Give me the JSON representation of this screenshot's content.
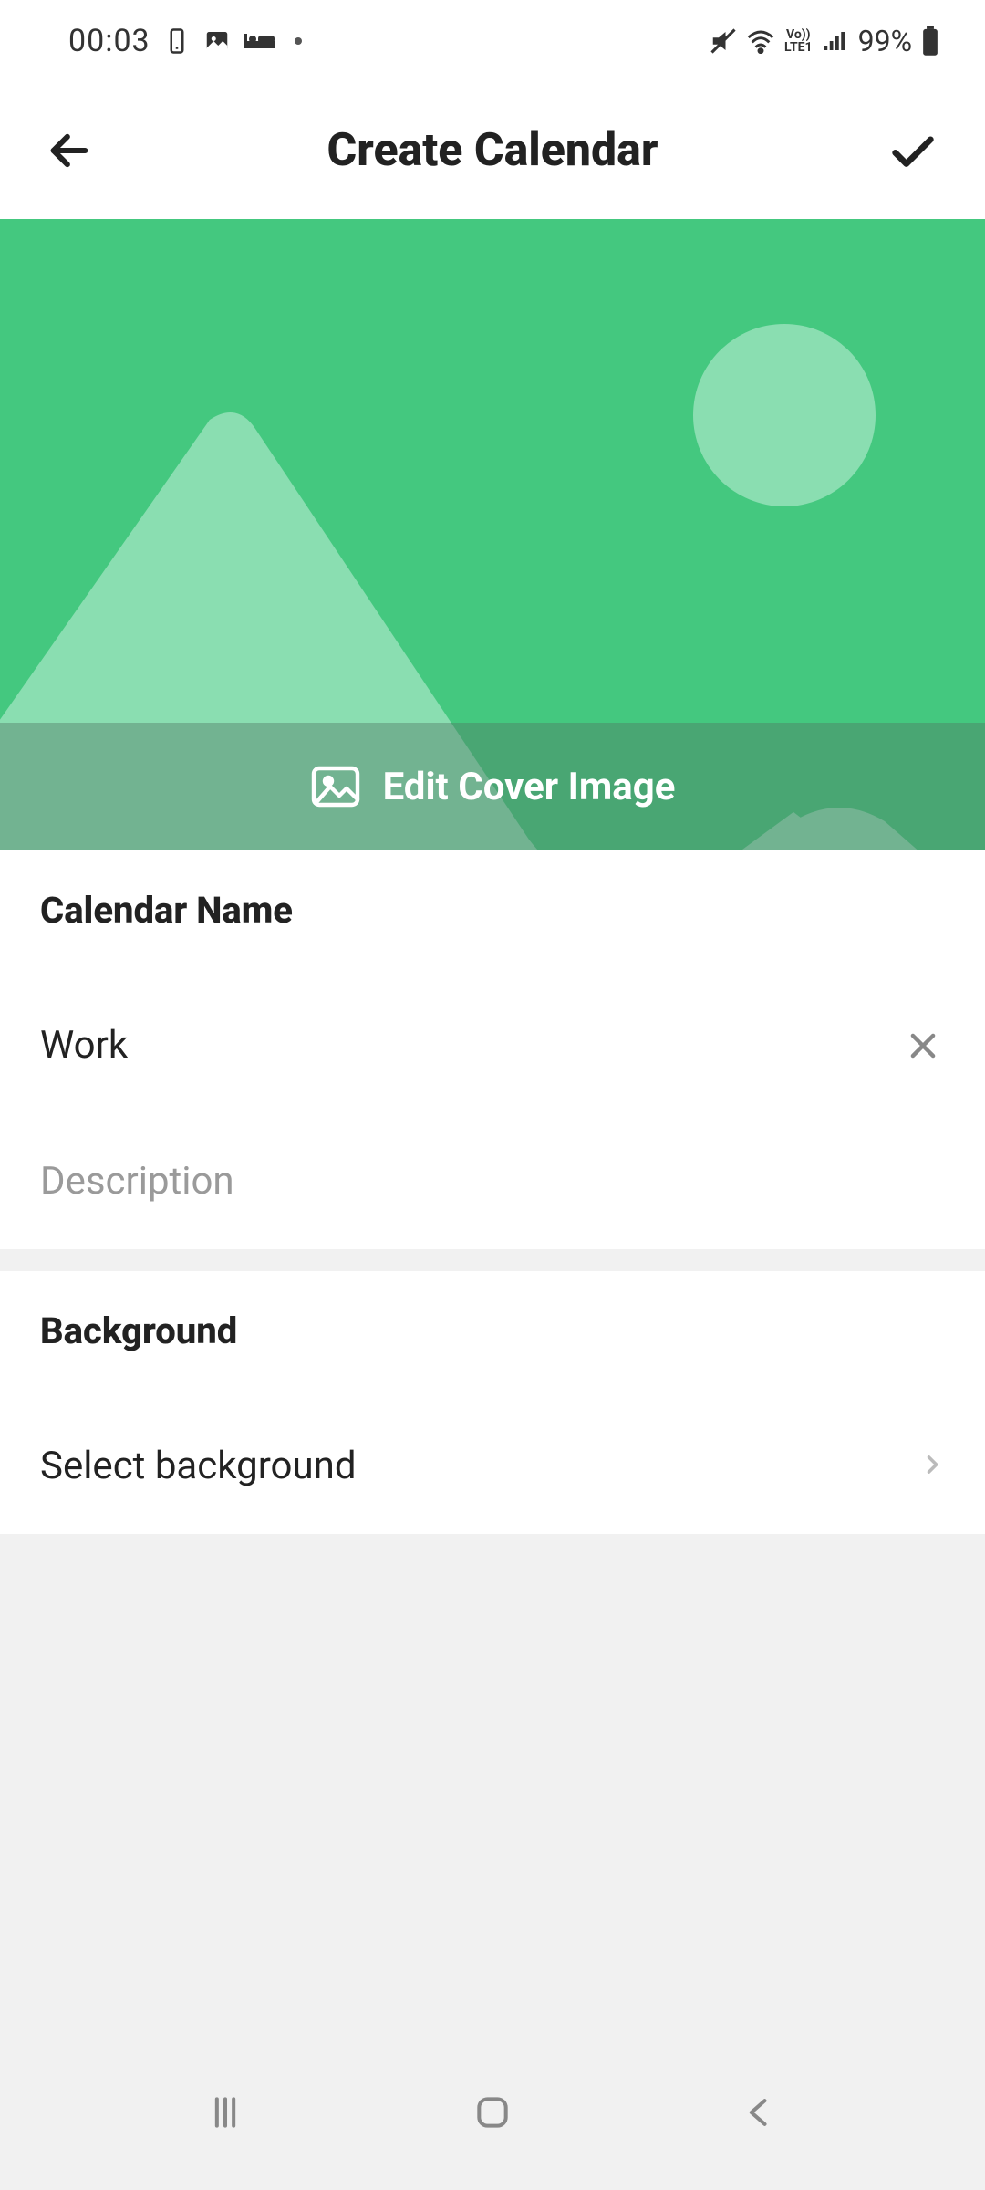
{
  "status": {
    "time": "00:03",
    "battery": "99%",
    "lte": "LTE1",
    "vo": "Vo))"
  },
  "appbar": {
    "title": "Create Calendar"
  },
  "cover": {
    "edit_label": "Edit Cover Image"
  },
  "form": {
    "name_label": "Calendar Name",
    "name_value": "Work",
    "description_placeholder": "Description",
    "description_value": ""
  },
  "background": {
    "label": "Background",
    "select_label": "Select background"
  }
}
